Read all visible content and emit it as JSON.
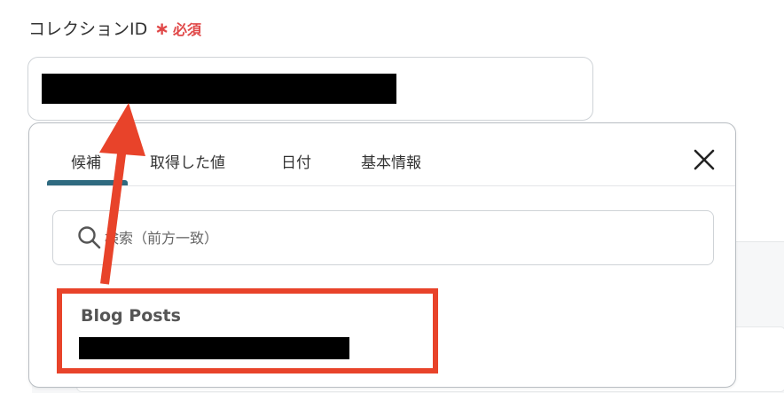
{
  "field": {
    "label": "コレクションID",
    "required_mark": "∗",
    "required_text": "必須",
    "value": "[redacted]"
  },
  "popup": {
    "tabs": [
      {
        "label": "候補",
        "active": true
      },
      {
        "label": "取得した値",
        "active": false
      },
      {
        "label": "日付",
        "active": false
      },
      {
        "label": "基本情報",
        "active": false
      }
    ],
    "close_icon": "close-icon",
    "search": {
      "icon": "search-icon",
      "placeholder": "検索（前方一致）",
      "value": ""
    },
    "options": [
      {
        "title": "Blog Posts",
        "subtitle": "[redacted]"
      }
    ]
  },
  "annotation": {
    "highlight_color": "#e8432a",
    "arrow_color": "#e8432a"
  },
  "colors": {
    "required": "#e04848",
    "tab_active_bar": "#2f6a80",
    "border": "#cfd3d7"
  }
}
